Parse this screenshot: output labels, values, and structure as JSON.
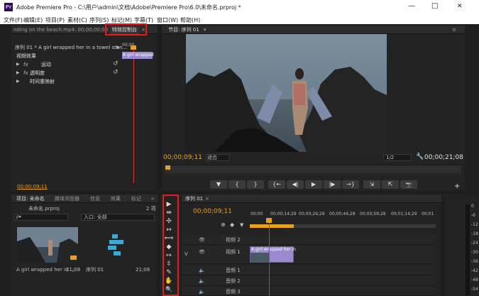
{
  "title_bar": {
    "app_icon": "Pr",
    "title": "Adobe Premiere Pro - C:\\用户\\admin\\文档\\Adobe\\Premiere Pro\\6.0\\未命名.prproj *",
    "minimize": "—",
    "maximize": "□",
    "close": "✕"
  },
  "menu": [
    "文件(F)",
    "编辑(E)",
    "项目(P)",
    "素材(C)",
    "序列(S)",
    "标记(M)",
    "字幕(T)",
    "窗口(W)",
    "帮助(H)"
  ],
  "effect_controls": {
    "source_tab": "nding on the beach.mp4: 00;00;00;00",
    "active_tab": "特效控制台",
    "close_x": "×",
    "clip_path": "序列 01 * A girl wrapped her in a towel stan...",
    "expand_arrow": "▶",
    "ruler_time": "00;00",
    "mini_clip": "A girl wrapped",
    "video_effects_label": "视频效果",
    "rows": [
      "运动",
      "透明度",
      "时间重映射"
    ],
    "fx_label": "fx",
    "reset_icon": "↺",
    "timecode": "00;00;09;11"
  },
  "program_monitor": {
    "tab": "节目: 序列 01",
    "dropdown_arrow": "▾",
    "menu_icon": "≡",
    "current_time": "00;00;09;11",
    "fit": "适合",
    "resolution": "1/2",
    "duration": "00;00;21;08",
    "controls": [
      "▼",
      "{",
      "}",
      "{←",
      "◀|",
      "▶",
      "|▶",
      "→}",
      "⇲",
      "⇱",
      "📷"
    ],
    "add": "+"
  },
  "project_panel": {
    "tabs": [
      "项目: 未命名",
      "媒体浏览器",
      "信息",
      "效果",
      "标记"
    ],
    "more": "»",
    "file": "未命名.prproj",
    "count": "2 项",
    "search_placeholder": "ρ▾",
    "in_label": "入口: 全部",
    "items": [
      {
        "name": "A girl wrapped her in ...",
        "duration": "21;08"
      },
      {
        "name": "序列 01",
        "duration": "21;08"
      }
    ]
  },
  "timeline": {
    "tab": "序列 01",
    "close": "×",
    "current_time": "00;00;09;11",
    "ruler": [
      "00;00",
      "00;00;14;29",
      "00;00;29;29",
      "00;00;44;28",
      "00;00;59;28",
      "00;01;14;29",
      "00;01"
    ],
    "tracks": [
      "视频 2",
      "视频 1",
      "音频 1",
      "音频 2",
      "音频 3"
    ],
    "v_label": "V",
    "clip": "A girl wrapped her in"
  },
  "tools": [
    "▶",
    "⇹",
    "✣",
    "↔",
    "⟺",
    "◆",
    "↦",
    "⇳",
    "✎",
    "✋",
    "🔍"
  ],
  "meter_labels": [
    "0",
    "-6",
    "-12",
    "-18",
    "-24",
    "-30",
    "-36",
    "-42",
    "-48",
    "-54"
  ],
  "colors": {
    "accent": "#e8a020",
    "playhead": "#d93535",
    "clip": "#9b8ad0",
    "highlight": "#e51a1a"
  }
}
